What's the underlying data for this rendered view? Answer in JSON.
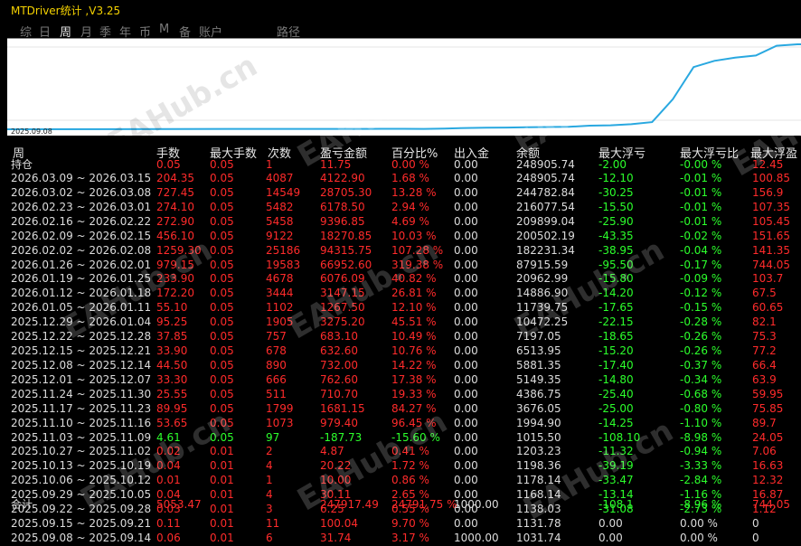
{
  "title": "MTDriver统计 ,V3.25",
  "tabs": [
    {
      "label": "综",
      "active": false
    },
    {
      "label": "日",
      "active": false
    },
    {
      "label": "周",
      "active": true
    },
    {
      "label": "月",
      "active": false
    },
    {
      "label": "季",
      "active": false
    },
    {
      "label": "年",
      "active": false
    },
    {
      "label": "币",
      "active": false
    },
    {
      "label": "M",
      "active": false
    },
    {
      "label": "备",
      "active": false
    },
    {
      "label": "账户",
      "active": false
    },
    {
      "label": "路径",
      "active": false
    }
  ],
  "chart": {
    "date_label": "2025.09.08",
    "line_color": "#29a8e0",
    "balance_series": [
      1031.74,
      1131.78,
      1138.03,
      1168.14,
      1178.14,
      1198.36,
      1203.23,
      1015.5,
      1994.9,
      3676.05,
      4386.75,
      5149.35,
      5881.35,
      6513.95,
      7197.05,
      10472.25,
      11739.75,
      14886.9,
      20962.99,
      87915.59,
      182231.34,
      200502.19,
      209899.04,
      216077.54,
      244782.84,
      248905.74
    ]
  },
  "headers": [
    "周",
    "手数",
    "最大手数",
    "次数",
    "盈亏金额",
    "百分比%",
    "出入金",
    "余额",
    "最大浮亏",
    "最大浮亏比",
    "最大浮盈"
  ],
  "holding": {
    "period": "持仓",
    "lots": "0.05",
    "max_lots": "0.05",
    "count": "1",
    "pnl": "11.75",
    "pct": "0.00 %",
    "io": "0.00",
    "balance": "248905.74",
    "max_fl": "-2.00",
    "max_fl_pct": "-0.00 %",
    "max_fp": "12.45"
  },
  "rows": [
    {
      "period": "2026.03.09 ~ 2026.03.15",
      "lots": "204.35",
      "max_lots": "0.05",
      "count": "4087",
      "pnl": "4122.90",
      "pct": "1.68 %",
      "io": "0.00",
      "balance": "248905.74",
      "max_fl": "-12.10",
      "max_fl_pct": "-0.01 %",
      "max_fp": "100.85",
      "color": "r"
    },
    {
      "period": "2026.03.02 ~ 2026.03.08",
      "lots": "727.45",
      "max_lots": "0.05",
      "count": "14549",
      "pnl": "28705.30",
      "pct": "13.28 %",
      "io": "0.00",
      "balance": "244782.84",
      "max_fl": "-30.25",
      "max_fl_pct": "-0.01 %",
      "max_fp": "156.9",
      "color": "r"
    },
    {
      "period": "2026.02.23 ~ 2026.03.01",
      "lots": "274.10",
      "max_lots": "0.05",
      "count": "5482",
      "pnl": "6178.50",
      "pct": "2.94 %",
      "io": "0.00",
      "balance": "216077.54",
      "max_fl": "-15.50",
      "max_fl_pct": "-0.01 %",
      "max_fp": "107.35",
      "color": "r"
    },
    {
      "period": "2026.02.16 ~ 2026.02.22",
      "lots": "272.90",
      "max_lots": "0.05",
      "count": "5458",
      "pnl": "9396.85",
      "pct": "4.69 %",
      "io": "0.00",
      "balance": "209899.04",
      "max_fl": "-25.90",
      "max_fl_pct": "-0.01 %",
      "max_fp": "105.45",
      "color": "r"
    },
    {
      "period": "2026.02.09 ~ 2026.02.15",
      "lots": "456.10",
      "max_lots": "0.05",
      "count": "9122",
      "pnl": "18270.85",
      "pct": "10.03 %",
      "io": "0.00",
      "balance": "200502.19",
      "max_fl": "-43.35",
      "max_fl_pct": "-0.02 %",
      "max_fp": "151.65",
      "color": "r"
    },
    {
      "period": "2026.02.02 ~ 2026.02.08",
      "lots": "1259.30",
      "max_lots": "0.05",
      "count": "25186",
      "pnl": "94315.75",
      "pct": "107.28 %",
      "io": "0.00",
      "balance": "182231.34",
      "max_fl": "-38.95",
      "max_fl_pct": "-0.04 %",
      "max_fp": "141.35",
      "color": "r"
    },
    {
      "period": "2026.01.26 ~ 2026.02.01",
      "lots": "979.15",
      "max_lots": "0.05",
      "count": "19583",
      "pnl": "66952.60",
      "pct": "319.38 %",
      "io": "0.00",
      "balance": "87915.59",
      "max_fl": "-95.50",
      "max_fl_pct": "-0.17 %",
      "max_fp": "744.05",
      "color": "r"
    },
    {
      "period": "2026.01.19 ~ 2026.01.25",
      "lots": "233.90",
      "max_lots": "0.05",
      "count": "4678",
      "pnl": "6076.09",
      "pct": "40.82 %",
      "io": "0.00",
      "balance": "20962.99",
      "max_fl": "-15.80",
      "max_fl_pct": "-0.09 %",
      "max_fp": "103.7",
      "color": "r"
    },
    {
      "period": "2026.01.12 ~ 2026.01.18",
      "lots": "172.20",
      "max_lots": "0.05",
      "count": "3444",
      "pnl": "3147.15",
      "pct": "26.81 %",
      "io": "0.00",
      "balance": "14886.90",
      "max_fl": "-14.20",
      "max_fl_pct": "-0.12 %",
      "max_fp": "67.5",
      "color": "r"
    },
    {
      "period": "2026.01.05 ~ 2026.01.11",
      "lots": "55.10",
      "max_lots": "0.05",
      "count": "1102",
      "pnl": "1267.50",
      "pct": "12.10 %",
      "io": "0.00",
      "balance": "11739.75",
      "max_fl": "-17.65",
      "max_fl_pct": "-0.15 %",
      "max_fp": "60.65",
      "color": "r"
    },
    {
      "period": "2025.12.29 ~ 2026.01.04",
      "lots": "95.25",
      "max_lots": "0.05",
      "count": "1905",
      "pnl": "3275.20",
      "pct": "45.51 %",
      "io": "0.00",
      "balance": "10472.25",
      "max_fl": "-22.15",
      "max_fl_pct": "-0.28 %",
      "max_fp": "82.1",
      "color": "r"
    },
    {
      "period": "2025.12.22 ~ 2025.12.28",
      "lots": "37.85",
      "max_lots": "0.05",
      "count": "757",
      "pnl": "683.10",
      "pct": "10.49 %",
      "io": "0.00",
      "balance": "7197.05",
      "max_fl": "-18.65",
      "max_fl_pct": "-0.26 %",
      "max_fp": "75.3",
      "color": "r"
    },
    {
      "period": "2025.12.15 ~ 2025.12.21",
      "lots": "33.90",
      "max_lots": "0.05",
      "count": "678",
      "pnl": "632.60",
      "pct": "10.76 %",
      "io": "0.00",
      "balance": "6513.95",
      "max_fl": "-15.20",
      "max_fl_pct": "-0.26 %",
      "max_fp": "77.2",
      "color": "r"
    },
    {
      "period": "2025.12.08 ~ 2025.12.14",
      "lots": "44.50",
      "max_lots": "0.05",
      "count": "890",
      "pnl": "732.00",
      "pct": "14.22 %",
      "io": "0.00",
      "balance": "5881.35",
      "max_fl": "-17.40",
      "max_fl_pct": "-0.37 %",
      "max_fp": "66.4",
      "color": "r"
    },
    {
      "period": "2025.12.01 ~ 2025.12.07",
      "lots": "33.30",
      "max_lots": "0.05",
      "count": "666",
      "pnl": "762.60",
      "pct": "17.38 %",
      "io": "0.00",
      "balance": "5149.35",
      "max_fl": "-14.80",
      "max_fl_pct": "-0.34 %",
      "max_fp": "63.9",
      "color": "r"
    },
    {
      "period": "2025.11.24 ~ 2025.11.30",
      "lots": "25.55",
      "max_lots": "0.05",
      "count": "511",
      "pnl": "710.70",
      "pct": "19.33 %",
      "io": "0.00",
      "balance": "4386.75",
      "max_fl": "-25.40",
      "max_fl_pct": "-0.68 %",
      "max_fp": "59.95",
      "color": "r"
    },
    {
      "period": "2025.11.17 ~ 2025.11.23",
      "lots": "89.95",
      "max_lots": "0.05",
      "count": "1799",
      "pnl": "1681.15",
      "pct": "84.27 %",
      "io": "0.00",
      "balance": "3676.05",
      "max_fl": "-25.00",
      "max_fl_pct": "-0.80 %",
      "max_fp": "75.85",
      "color": "r"
    },
    {
      "period": "2025.11.10 ~ 2025.11.16",
      "lots": "53.65",
      "max_lots": "0.05",
      "count": "1073",
      "pnl": "979.40",
      "pct": "96.45 %",
      "io": "0.00",
      "balance": "1994.90",
      "max_fl": "-14.25",
      "max_fl_pct": "-1.10 %",
      "max_fp": "89.7",
      "color": "r"
    },
    {
      "period": "2025.11.03 ~ 2025.11.09",
      "lots": "4.61",
      "max_lots": "0.05",
      "count": "97",
      "pnl": "-187.73",
      "pct": "-15.60 %",
      "io": "0.00",
      "balance": "1015.50",
      "max_fl": "-108.10",
      "max_fl_pct": "-8.98 %",
      "max_fp": "24.05",
      "color": "g"
    },
    {
      "period": "2025.10.27 ~ 2025.11.02",
      "lots": "0.02",
      "max_lots": "0.01",
      "count": "2",
      "pnl": "4.87",
      "pct": "0.41 %",
      "io": "0.00",
      "balance": "1203.23",
      "max_fl": "-11.32",
      "max_fl_pct": "-0.94 %",
      "max_fp": "7.06",
      "color": "r"
    },
    {
      "period": "2025.10.13 ~ 2025.10.19",
      "lots": "0.04",
      "max_lots": "0.01",
      "count": "4",
      "pnl": "20.22",
      "pct": "1.72 %",
      "io": "0.00",
      "balance": "1198.36",
      "max_fl": "-39.19",
      "max_fl_pct": "-3.33 %",
      "max_fp": "16.63",
      "color": "r"
    },
    {
      "period": "2025.10.06 ~ 2025.10.12",
      "lots": "0.01",
      "max_lots": "0.01",
      "count": "1",
      "pnl": "10.00",
      "pct": "0.86 %",
      "io": "0.00",
      "balance": "1178.14",
      "max_fl": "-33.47",
      "max_fl_pct": "-2.84 %",
      "max_fp": "12.32",
      "color": "r"
    },
    {
      "period": "2025.09.29 ~ 2025.10.05",
      "lots": "0.04",
      "max_lots": "0.01",
      "count": "4",
      "pnl": "30.11",
      "pct": "2.65 %",
      "io": "0.00",
      "balance": "1168.14",
      "max_fl": "-13.14",
      "max_fl_pct": "-1.16 %",
      "max_fp": "16.87",
      "color": "r"
    },
    {
      "period": "2025.09.22 ~ 2025.09.28",
      "lots": "0.03",
      "max_lots": "0.01",
      "count": "3",
      "pnl": "6.25",
      "pct": "0.55 %",
      "io": "0.00",
      "balance": "1138.03",
      "max_fl": "-31.08",
      "max_fl_pct": "-2.73 %",
      "max_fp": "1.12",
      "color": "r"
    },
    {
      "period": "2025.09.15 ~ 2025.09.21",
      "lots": "0.11",
      "max_lots": "0.01",
      "count": "11",
      "pnl": "100.04",
      "pct": "9.70 %",
      "io": "0.00",
      "balance": "1131.78",
      "max_fl": "0.00",
      "max_fl_pct": "0.00 %",
      "max_fp": "0",
      "color": "r"
    },
    {
      "period": "2025.09.08 ~ 2025.09.14",
      "lots": "0.06",
      "max_lots": "0.01",
      "count": "6",
      "pnl": "31.74",
      "pct": "3.17 %",
      "io": "1000.00",
      "balance": "1031.74",
      "max_fl": "0.00",
      "max_fl_pct": "0.00 %",
      "max_fp": "0",
      "color": "r"
    }
  ],
  "total": {
    "period": "合计",
    "lots": "5053.47",
    "max_lots": "",
    "count": "",
    "pnl": "247917.49",
    "pct": "24791.75 %",
    "io": "1000.00",
    "balance": "",
    "max_fl": "-108.1",
    "max_fl_pct": "-8.96 %",
    "max_fp": "744.05"
  },
  "watermark": "EAHub.cn"
}
